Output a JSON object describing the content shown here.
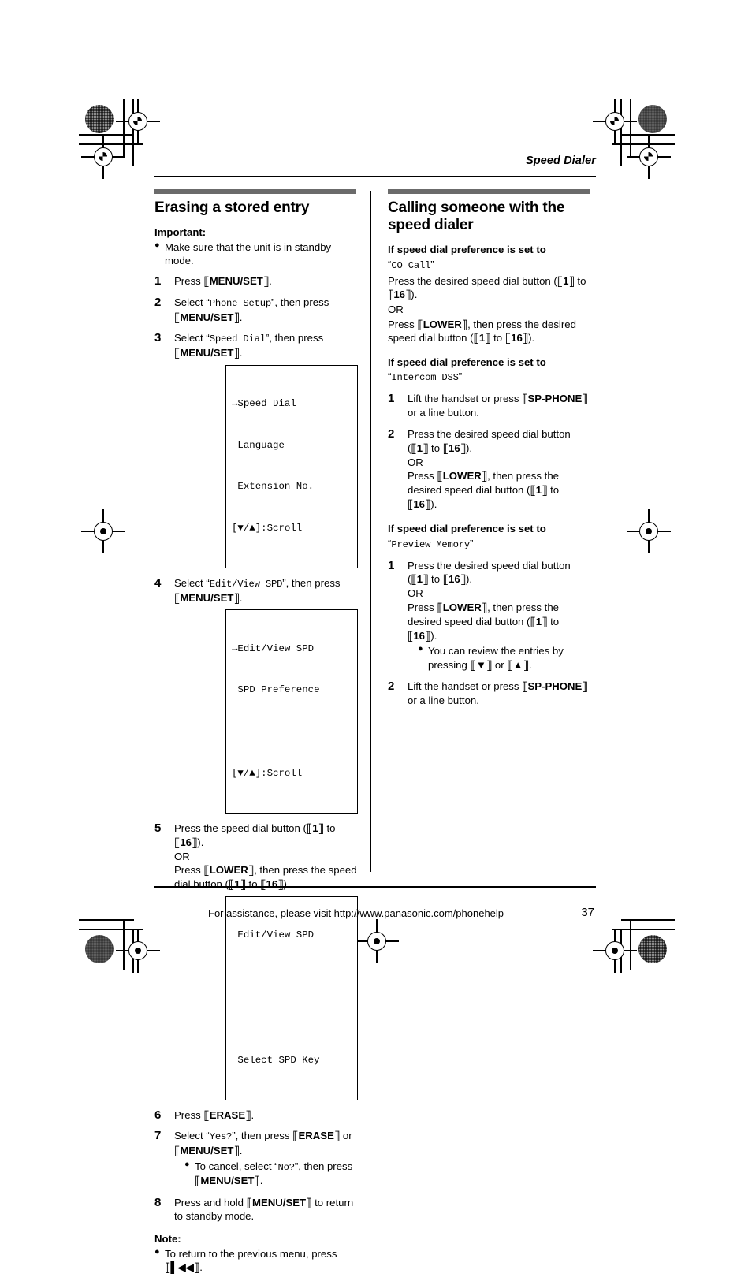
{
  "running_head": "Speed Dialer",
  "left_column": {
    "heading": "Erasing a stored entry",
    "important_label": "Important:",
    "important_bullet_a": "Make sure that the unit is in standby",
    "important_bullet_b": "mode.",
    "steps": {
      "s1_num": "1",
      "s1_press": "Press ",
      "s1_key": "MENU/SET",
      "s1_end": ".",
      "s2_num": "2",
      "s2_a": "Select “",
      "s2_mono": "Phone Setup",
      "s2_b": "”, then press ",
      "s2_key": "MENU/SET",
      "s2_end": ".",
      "s3_num": "3",
      "s3_a": "Select “",
      "s3_mono": "Speed Dial",
      "s3_b": "”, then press ",
      "s3_key": "MENU/SET",
      "s3_end": ".",
      "s4_num": "4",
      "s4_a": "Select “",
      "s4_mono": "Edit/View SPD",
      "s4_b": "”, then press ",
      "s4_key": "MENU/SET",
      "s4_end": ".",
      "s5_num": "5",
      "s5_a": "Press the speed dial button (",
      "s5_k1": "1",
      "s5_b": " to ",
      "s5_k2": "16",
      "s5_c": ").",
      "s5_or": "OR",
      "s5_d": "Press ",
      "s5_k3": "LOWER",
      "s5_e": ", then press the speed dial button (",
      "s5_k4": "1",
      "s5_f": " to ",
      "s5_k5": "16",
      "s5_g": ").",
      "s6_num": "6",
      "s6_a": "Press ",
      "s6_key": "ERASE",
      "s6_end": ".",
      "s7_num": "7",
      "s7_a": "Select “",
      "s7_mono": "Yes?",
      "s7_b": "”, then press ",
      "s7_k1": "ERASE",
      "s7_c": " or ",
      "s7_k2": "MENU/SET",
      "s7_d": ".",
      "s7_sub_a": "To cancel, select “",
      "s7_sub_mono": "No?",
      "s7_sub_b": "”, then press ",
      "s7_sub_key": "MENU/SET",
      "s7_sub_c": ".",
      "s8_num": "8",
      "s8_a": "Press and hold ",
      "s8_key": "MENU/SET",
      "s8_b": " to return to standby mode."
    },
    "lcd_1": {
      "line1": "→Speed Dial",
      "line2": " Language",
      "line3": " Extension No.",
      "line4": "[▼/▲]:Scroll"
    },
    "lcd_2": {
      "line1": "→Edit/View SPD",
      "line2": " SPD Preference",
      "line3": "",
      "line4": "[▼/▲]:Scroll"
    },
    "lcd_3": {
      "line1": " Edit/View SPD",
      "line2": "",
      "line3": "",
      "line4": " Select SPD Key"
    },
    "note_label": "Note:",
    "note_a": "To return to the previous menu, press ",
    "note_key": "▌◀◀",
    "note_b": "."
  },
  "right_column": {
    "heading": "Calling someone with the speed dialer",
    "block_co": {
      "bold_line": "If speed dial preference is set to",
      "quote_open": "“",
      "mono_name": "CO Call",
      "quote_close": "”",
      "p1_a": "Press the desired speed dial button (",
      "p1_k1": "1",
      "p1_b": " to ",
      "p1_k2": "16",
      "p1_c": ").",
      "or": "OR",
      "p2_a": "Press ",
      "p2_k1": "LOWER",
      "p2_b": ", then press the desired speed dial button (",
      "p2_k2": "1",
      "p2_c": " to ",
      "p2_k3": "16",
      "p2_d": ")."
    },
    "block_dss": {
      "bold_line": "If speed dial preference is set to",
      "quote_open": "“",
      "mono_name": "Intercom DSS",
      "quote_close": "”",
      "s1_num": "1",
      "s1_a": "Lift the handset or press ",
      "s1_key": "SP-PHONE",
      "s1_b": " or a line button.",
      "s2_num": "2",
      "s2_a": "Press the desired speed dial button (",
      "s2_k1": "1",
      "s2_b": " to ",
      "s2_k2": "16",
      "s2_c": ").",
      "s2_or": "OR",
      "s2_d": "Press ",
      "s2_k3": "LOWER",
      "s2_e": ", then press the desired speed dial button (",
      "s2_k4": "1",
      "s2_f": " to ",
      "s2_k5": "16",
      "s2_g": ")."
    },
    "block_preview": {
      "bold_line": "If speed dial preference is set to",
      "quote_open": "“",
      "mono_name": "Preview Memory",
      "quote_close": "”",
      "s1_num": "1",
      "s1_a": "Press the desired speed dial button (",
      "s1_k1": "1",
      "s1_b": " to ",
      "s1_k2": "16",
      "s1_c": ").",
      "s1_or": "OR",
      "s1_d": "Press ",
      "s1_k3": "LOWER",
      "s1_e": ", then press the desired speed dial button (",
      "s1_k4": "1",
      "s1_f": " to ",
      "s1_k5": "16",
      "s1_g": ").",
      "bullet_a": "You can review the entries by pressing ",
      "bullet_k1": "▼",
      "bullet_b": " or ",
      "bullet_k2": "▲",
      "bullet_c": ".",
      "s2_num": "2",
      "s2_a": "Lift the handset or press ",
      "s2_key": "SP-PHONE",
      "s2_b": " or a line button."
    }
  },
  "footer": {
    "assistance": "For assistance, please visit http://www.panasonic.com/phonehelp",
    "page_number": "37"
  },
  "colors": {
    "section_bar": "#6b6b6b",
    "text": "#000000",
    "page_background": "#ffffff"
  }
}
